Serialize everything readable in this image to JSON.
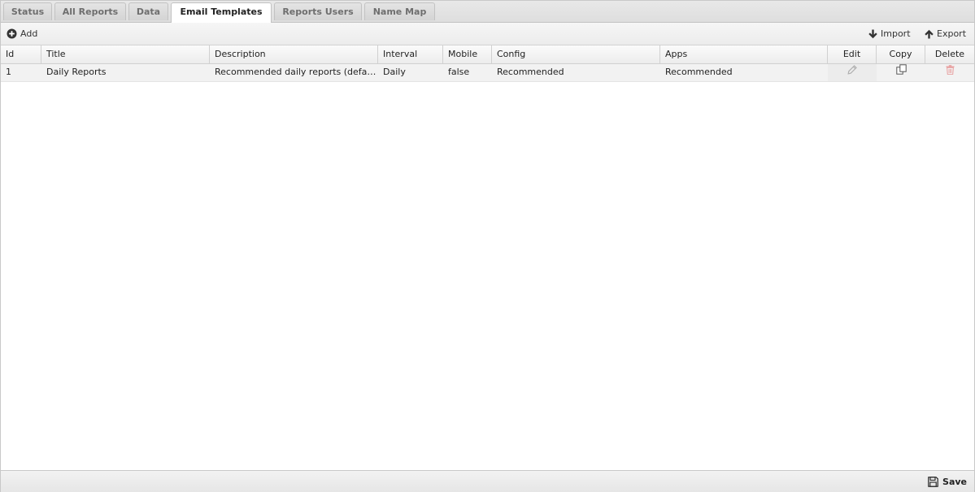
{
  "tabs": [
    {
      "label": "Status"
    },
    {
      "label": "All Reports"
    },
    {
      "label": "Data"
    },
    {
      "label": "Email Templates",
      "active": true
    },
    {
      "label": "Reports Users"
    },
    {
      "label": "Name Map"
    }
  ],
  "toolbar": {
    "add_label": "Add",
    "import_label": "Import",
    "export_label": "Export"
  },
  "grid": {
    "columns": [
      "Id",
      "Title",
      "Description",
      "Interval",
      "Mobile",
      "Config",
      "Apps",
      "Edit",
      "Copy",
      "Delete"
    ],
    "rows": [
      {
        "id": "1",
        "title": "Daily Reports",
        "description": "Recommended daily reports (default)",
        "interval": "Daily",
        "mobile": "false",
        "config": "Recommended",
        "apps": "Recommended"
      }
    ]
  },
  "footer": {
    "save_label": "Save"
  },
  "icons": {
    "add": "plus-circle-icon",
    "import": "arrow-down-icon",
    "export": "arrow-up-icon",
    "edit": "pencil-icon",
    "copy": "copy-icon",
    "delete": "trash-icon",
    "save": "floppy-disk-icon"
  },
  "colors": {
    "delete_icon": "#e8a0a0",
    "edit_icon": "#b0b0b0",
    "active_tab": "#ffffff",
    "row_background": "#f2f2f2"
  }
}
